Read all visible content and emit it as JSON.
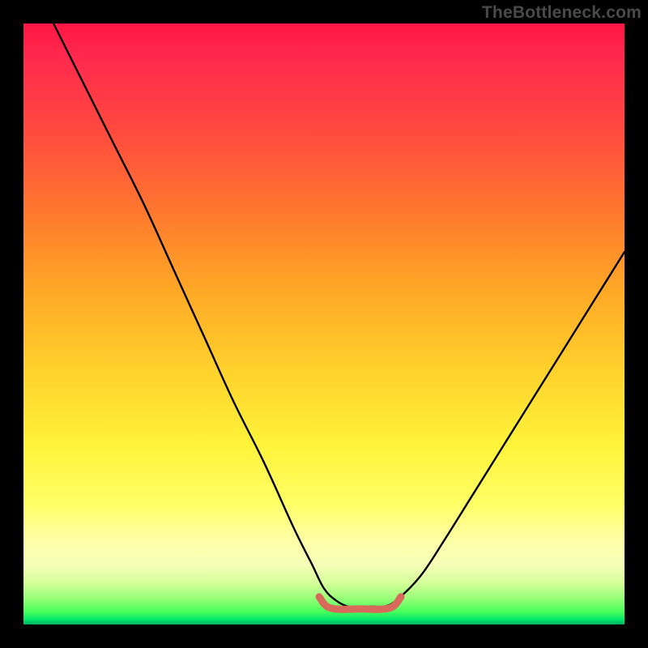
{
  "watermark": "TheBottleneck.com",
  "colors": {
    "frame": "#000000",
    "gradient_top": "#ff1744",
    "gradient_mid": "#fff33a",
    "gradient_bottom": "#00b060",
    "curve_stroke": "#000000",
    "highlight_stroke": "#d86a5c"
  },
  "chart_data": {
    "type": "line",
    "title": "",
    "xlabel": "",
    "ylabel": "",
    "xlim": [
      0,
      100
    ],
    "ylim": [
      0,
      100
    ],
    "series": [
      {
        "name": "bottleneck-curve",
        "x": [
          5,
          10,
          15,
          20,
          25,
          30,
          35,
          40,
          45,
          48,
          50,
          52,
          54,
          56,
          58,
          60,
          62,
          66,
          70,
          75,
          80,
          85,
          90,
          95,
          100
        ],
        "values": [
          100,
          90,
          80,
          70,
          59,
          48,
          37,
          27,
          16,
          10,
          6,
          4,
          3,
          3,
          3,
          3,
          4,
          8,
          14,
          22,
          30,
          38,
          46,
          54,
          62
        ]
      }
    ],
    "annotations": [
      {
        "name": "optimal-range",
        "x_start": 50,
        "x_end": 62,
        "y": 3,
        "note": "highlighted flat minimum"
      }
    ]
  }
}
